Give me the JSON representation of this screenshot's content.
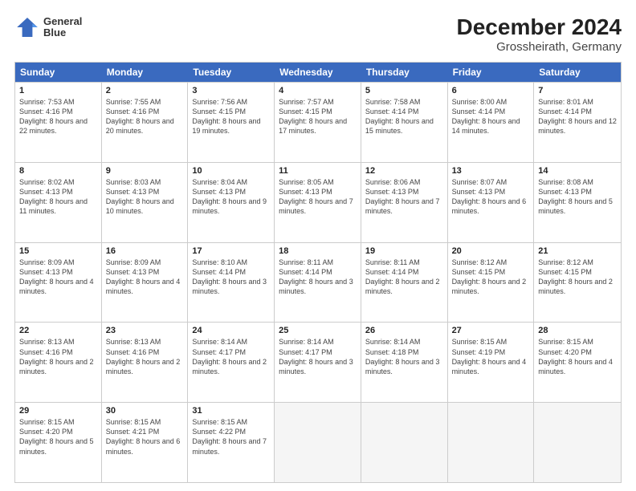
{
  "header": {
    "logo_text_top": "General",
    "logo_text_bottom": "Blue",
    "title": "December 2024",
    "subtitle": "Grossheirath, Germany"
  },
  "days_of_week": [
    "Sunday",
    "Monday",
    "Tuesday",
    "Wednesday",
    "Thursday",
    "Friday",
    "Saturday"
  ],
  "weeks": [
    [
      {
        "num": "1",
        "sunrise": "7:53 AM",
        "sunset": "4:16 PM",
        "daylight": "8 hours and 22 minutes."
      },
      {
        "num": "2",
        "sunrise": "7:55 AM",
        "sunset": "4:16 PM",
        "daylight": "8 hours and 20 minutes."
      },
      {
        "num": "3",
        "sunrise": "7:56 AM",
        "sunset": "4:15 PM",
        "daylight": "8 hours and 19 minutes."
      },
      {
        "num": "4",
        "sunrise": "7:57 AM",
        "sunset": "4:15 PM",
        "daylight": "8 hours and 17 minutes."
      },
      {
        "num": "5",
        "sunrise": "7:58 AM",
        "sunset": "4:14 PM",
        "daylight": "8 hours and 15 minutes."
      },
      {
        "num": "6",
        "sunrise": "8:00 AM",
        "sunset": "4:14 PM",
        "daylight": "8 hours and 14 minutes."
      },
      {
        "num": "7",
        "sunrise": "8:01 AM",
        "sunset": "4:14 PM",
        "daylight": "8 hours and 12 minutes."
      }
    ],
    [
      {
        "num": "8",
        "sunrise": "8:02 AM",
        "sunset": "4:13 PM",
        "daylight": "8 hours and 11 minutes."
      },
      {
        "num": "9",
        "sunrise": "8:03 AM",
        "sunset": "4:13 PM",
        "daylight": "8 hours and 10 minutes."
      },
      {
        "num": "10",
        "sunrise": "8:04 AM",
        "sunset": "4:13 PM",
        "daylight": "8 hours and 9 minutes."
      },
      {
        "num": "11",
        "sunrise": "8:05 AM",
        "sunset": "4:13 PM",
        "daylight": "8 hours and 7 minutes."
      },
      {
        "num": "12",
        "sunrise": "8:06 AM",
        "sunset": "4:13 PM",
        "daylight": "8 hours and 7 minutes."
      },
      {
        "num": "13",
        "sunrise": "8:07 AM",
        "sunset": "4:13 PM",
        "daylight": "8 hours and 6 minutes."
      },
      {
        "num": "14",
        "sunrise": "8:08 AM",
        "sunset": "4:13 PM",
        "daylight": "8 hours and 5 minutes."
      }
    ],
    [
      {
        "num": "15",
        "sunrise": "8:09 AM",
        "sunset": "4:13 PM",
        "daylight": "8 hours and 4 minutes."
      },
      {
        "num": "16",
        "sunrise": "8:09 AM",
        "sunset": "4:13 PM",
        "daylight": "8 hours and 4 minutes."
      },
      {
        "num": "17",
        "sunrise": "8:10 AM",
        "sunset": "4:14 PM",
        "daylight": "8 hours and 3 minutes."
      },
      {
        "num": "18",
        "sunrise": "8:11 AM",
        "sunset": "4:14 PM",
        "daylight": "8 hours and 3 minutes."
      },
      {
        "num": "19",
        "sunrise": "8:11 AM",
        "sunset": "4:14 PM",
        "daylight": "8 hours and 2 minutes."
      },
      {
        "num": "20",
        "sunrise": "8:12 AM",
        "sunset": "4:15 PM",
        "daylight": "8 hours and 2 minutes."
      },
      {
        "num": "21",
        "sunrise": "8:12 AM",
        "sunset": "4:15 PM",
        "daylight": "8 hours and 2 minutes."
      }
    ],
    [
      {
        "num": "22",
        "sunrise": "8:13 AM",
        "sunset": "4:16 PM",
        "daylight": "8 hours and 2 minutes."
      },
      {
        "num": "23",
        "sunrise": "8:13 AM",
        "sunset": "4:16 PM",
        "daylight": "8 hours and 2 minutes."
      },
      {
        "num": "24",
        "sunrise": "8:14 AM",
        "sunset": "4:17 PM",
        "daylight": "8 hours and 2 minutes."
      },
      {
        "num": "25",
        "sunrise": "8:14 AM",
        "sunset": "4:17 PM",
        "daylight": "8 hours and 3 minutes."
      },
      {
        "num": "26",
        "sunrise": "8:14 AM",
        "sunset": "4:18 PM",
        "daylight": "8 hours and 3 minutes."
      },
      {
        "num": "27",
        "sunrise": "8:15 AM",
        "sunset": "4:19 PM",
        "daylight": "8 hours and 4 minutes."
      },
      {
        "num": "28",
        "sunrise": "8:15 AM",
        "sunset": "4:20 PM",
        "daylight": "8 hours and 4 minutes."
      }
    ],
    [
      {
        "num": "29",
        "sunrise": "8:15 AM",
        "sunset": "4:20 PM",
        "daylight": "8 hours and 5 minutes."
      },
      {
        "num": "30",
        "sunrise": "8:15 AM",
        "sunset": "4:21 PM",
        "daylight": "8 hours and 6 minutes."
      },
      {
        "num": "31",
        "sunrise": "8:15 AM",
        "sunset": "4:22 PM",
        "daylight": "8 hours and 7 minutes."
      },
      null,
      null,
      null,
      null
    ]
  ]
}
